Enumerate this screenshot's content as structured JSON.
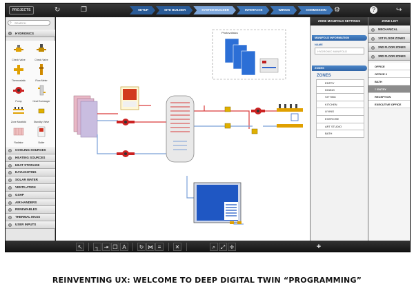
{
  "topbar": {
    "projects_label": "PROJECTS",
    "steps": [
      "SETUP",
      "SITE BUILDER",
      "SYSTEM BUILDER",
      "INTERFACE",
      "WIRING",
      "COMMISSION"
    ]
  },
  "search": {
    "placeholder": "SEARCH"
  },
  "library": {
    "section_title": "HYDRONICS",
    "components": [
      {
        "label": "Check Valve",
        "icon": "check-valve-icon"
      },
      {
        "label": "Check Valve",
        "icon": "check-valve-icon"
      },
      {
        "label": "Thermostatic",
        "icon": "thermostatic-valve-icon"
      },
      {
        "label": "Flow Meter",
        "icon": "flow-meter-icon"
      },
      {
        "label": "Pump",
        "icon": "pump-icon"
      },
      {
        "label": "Heat Exchanger",
        "icon": "heat-exchanger-icon"
      },
      {
        "label": "Zone Manifold",
        "icon": "zone-manifold-icon"
      },
      {
        "label": "Standby Valve",
        "icon": "standby-valve-icon"
      },
      {
        "label": "Radiator",
        "icon": "radiator-icon"
      },
      {
        "label": "Boiler",
        "icon": "boiler-icon"
      }
    ],
    "categories": [
      "COOLING SOURCES",
      "HEATING SOURCES",
      "HEAT STORAGE",
      "DAYLIGHTING",
      "SOLAR WATER",
      "VENTILATION",
      "GSHP",
      "AIR HANDERS",
      "RENEWABLES",
      "THERMAL MASS",
      "USER INPUTS"
    ]
  },
  "canvas": {
    "photovoltaics_label": "Photovoltaics"
  },
  "manifold": {
    "title": "ZONE MANIFOLD SETTINGS",
    "info_header": "MANIFOLD INFORMATION",
    "name_label": "NAME",
    "name_value": "HYDRONIC MANIFOLD",
    "zones_header": "ZONES",
    "zones_label": "ZONES",
    "zones": [
      "ENTRY",
      "DINING",
      "SITTING",
      "KITCHEN",
      "LIVING",
      "EXERCISE",
      "ART STUDIO",
      "BATH"
    ]
  },
  "zonelist": {
    "title": "ZONE LIST",
    "groups": [
      "MECHANICAL",
      "1ST FLOOR ZONES",
      "2ND FLOOR ZONES",
      "3RD FLOOR ZONES"
    ],
    "items": [
      "OFFICE",
      "OFFICE 2",
      "BATH",
      "ENTRY",
      "RECEPTION",
      "EXECUTIVE OFFICE"
    ],
    "selected": "ENTRY"
  },
  "bottombar": {
    "add_label": "+"
  },
  "caption": "REINVENTING UX: WELCOME TO DEEP DIGITAL TWIN “PROGRAMMING”",
  "colors": {
    "accent": "#3d74b5",
    "pipe_hot": "#d93a3a",
    "pipe_cold": "#7aa0d8",
    "panel_dark": "#1e1e1e"
  }
}
